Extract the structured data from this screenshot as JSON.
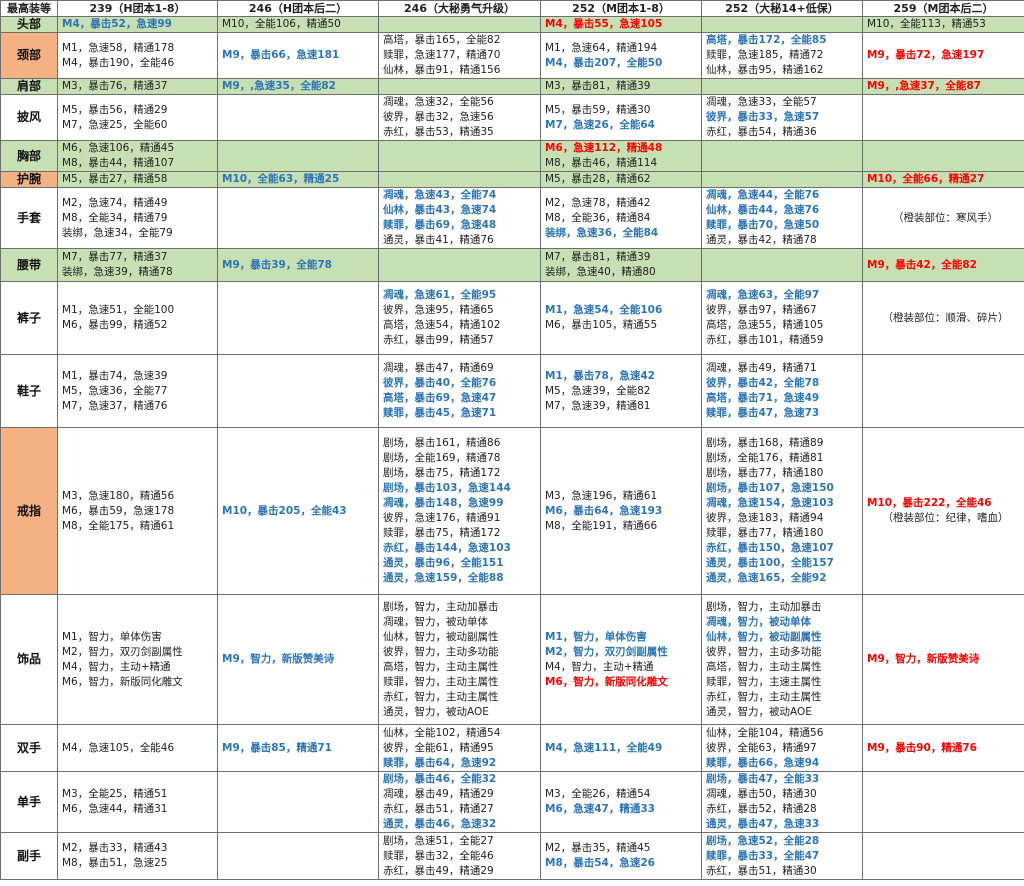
{
  "header": [
    "最高装等",
    "239（H团本1-8）",
    "246（H团本后二）",
    "246（大秘勇气升级）",
    "252（M团本1-8）",
    "252（大秘14+低保）",
    "259（M团本后二）"
  ],
  "rows": [
    {
      "slot": "头部",
      "green": true,
      "orange": false,
      "h": 15,
      "cells": [
        [
          {
            "t": "M4，暴击52，急速99",
            "c": "blue"
          }
        ],
        [
          {
            "t": "M10，全能106，精通50",
            "c": ""
          }
        ],
        [],
        [
          {
            "t": "M4，暴击55，急速105",
            "c": "red"
          }
        ],
        [],
        [
          {
            "t": "M10，全能113，精通53",
            "c": ""
          }
        ]
      ]
    },
    {
      "slot": "颈部",
      "green": false,
      "orange": true,
      "h": 46,
      "cells": [
        [
          {
            "t": "M1，急速58，精通178",
            "c": ""
          },
          {
            "t": "M4，暴击190，全能46",
            "c": ""
          }
        ],
        [
          {
            "t": "M9，暴击66，急速181",
            "c": "blue"
          }
        ],
        [
          {
            "t": "高塔，暴击165，全能82",
            "c": ""
          },
          {
            "t": "赎罪，急速177，精通70",
            "c": ""
          },
          {
            "t": "仙林，暴击91，精通156",
            "c": ""
          }
        ],
        [
          {
            "t": "M1，急速64，精通194",
            "c": ""
          },
          {
            "t": "M4，暴击207，全能50",
            "c": "blue"
          }
        ],
        [
          {
            "t": "高塔，暴击172，全能85",
            "c": "blue"
          },
          {
            "t": "赎罪，急速185，精通72",
            "c": ""
          },
          {
            "t": "仙林，暴击95，精通162",
            "c": ""
          }
        ],
        [
          {
            "t": "M9，暴击72，急速197",
            "c": "red"
          }
        ]
      ]
    },
    {
      "slot": "肩部",
      "green": true,
      "orange": false,
      "h": 15,
      "cells": [
        [
          {
            "t": "M3，暴击76，精通37",
            "c": ""
          }
        ],
        [
          {
            "t": "M9，,急速35，全能82",
            "c": "blue"
          }
        ],
        [],
        [
          {
            "t": "M3，暴击81，精通39",
            "c": ""
          }
        ],
        [],
        [
          {
            "t": "M9，,急速37，全能87",
            "c": "red"
          }
        ]
      ]
    },
    {
      "slot": "披风",
      "green": false,
      "orange": false,
      "h": 46,
      "cells": [
        [
          {
            "t": "M5，暴击56，精通29",
            "c": ""
          },
          {
            "t": "M7，急速25，全能60",
            "c": ""
          }
        ],
        [],
        [
          {
            "t": "凋魂，急速32，全能56",
            "c": ""
          },
          {
            "t": "彼界，暴击32，急速56",
            "c": ""
          },
          {
            "t": "赤红，暴击53，精通35",
            "c": ""
          }
        ],
        [
          {
            "t": "M5，暴击59，精通30",
            "c": ""
          },
          {
            "t": "M7，急速26，全能64",
            "c": "blue"
          }
        ],
        [
          {
            "t": "凋魂，急速33，全能57",
            "c": ""
          },
          {
            "t": "彼界，暴击33，急速57",
            "c": "blue"
          },
          {
            "t": "赤红，暴击54，精通36",
            "c": ""
          }
        ],
        []
      ]
    },
    {
      "slot": "胸部",
      "green": true,
      "orange": false,
      "h": 31,
      "cells": [
        [
          {
            "t": "M6，急速106，精通45",
            "c": ""
          },
          {
            "t": "M8，暴击44，精通107",
            "c": ""
          }
        ],
        [],
        [],
        [
          {
            "t": "M6，急速112，精通48",
            "c": "red"
          },
          {
            "t": "M8，暴击46，精通114",
            "c": ""
          }
        ],
        [],
        []
      ]
    },
    {
      "slot": "护腕",
      "green": true,
      "orange": true,
      "h": 15,
      "cells": [
        [
          {
            "t": "M5，暴击27，精通58",
            "c": ""
          }
        ],
        [
          {
            "t": "M10，全能63，精通25",
            "c": "blue"
          }
        ],
        [],
        [
          {
            "t": "M5，暴击28，精通62",
            "c": ""
          }
        ],
        [],
        [
          {
            "t": "M10，全能66，精通27",
            "c": "red"
          }
        ]
      ]
    },
    {
      "slot": "手套",
      "green": false,
      "orange": false,
      "h": 61,
      "cells": [
        [
          {
            "t": "M2，急速74，精通49",
            "c": ""
          },
          {
            "t": "M8，全能34，精通79",
            "c": ""
          },
          {
            "t": "装绑，急速34，全能79",
            "c": ""
          }
        ],
        [],
        [
          {
            "t": "凋魂，急速43，全能74",
            "c": "blue"
          },
          {
            "t": "仙林，暴击43，急速74",
            "c": "blue"
          },
          {
            "t": "赎罪，暴击69，急速48",
            "c": "blue"
          },
          {
            "t": "通灵，暴击41，精通76",
            "c": ""
          }
        ],
        [
          {
            "t": "M2，急速78，精通42",
            "c": ""
          },
          {
            "t": "M8，全能36，精通84",
            "c": ""
          },
          {
            "t": "装绑，急速36，全能84",
            "c": "blue"
          }
        ],
        [
          {
            "t": "凋魂，急速44，全能76",
            "c": "blue"
          },
          {
            "t": "仙林，暴击44，急速76",
            "c": "blue"
          },
          {
            "t": "赎罪，暴击70，急速50",
            "c": "blue"
          },
          {
            "t": "通灵，暴击42，精通78",
            "c": ""
          }
        ],
        [
          {
            "t": "（橙装部位：寒风手）",
            "c": "note"
          }
        ]
      ]
    },
    {
      "slot": "腰带",
      "green": true,
      "orange": false,
      "h": 33,
      "cells": [
        [
          {
            "t": "M7，暴击77，精通37",
            "c": ""
          },
          {
            "t": "装绑，急速39，精通78",
            "c": ""
          }
        ],
        [
          {
            "t": "M9，暴击39，全能78",
            "c": "blue"
          }
        ],
        [],
        [
          {
            "t": "M7，暴击81，精通39",
            "c": ""
          },
          {
            "t": "装绑，急速40，精通80",
            "c": ""
          }
        ],
        [],
        [
          {
            "t": "M9，暴击42，全能82",
            "c": "red"
          }
        ]
      ]
    },
    {
      "slot": "裤子",
      "green": false,
      "orange": false,
      "h": 73,
      "cells": [
        [
          {
            "t": "M1，急速51，全能100",
            "c": ""
          },
          {
            "t": "M6，暴击99，精通52",
            "c": ""
          }
        ],
        [],
        [
          {
            "t": "凋魂，急速61，全能95",
            "c": "blue"
          },
          {
            "t": "彼界，急速95，精通65",
            "c": ""
          },
          {
            "t": "高塔，急速54，精通102",
            "c": ""
          },
          {
            "t": "赤红，暴击99，精通57",
            "c": ""
          }
        ],
        [
          {
            "t": "M1，急速54，全能106",
            "c": "blue"
          },
          {
            "t": "M6，暴击105，精通55",
            "c": ""
          }
        ],
        [
          {
            "t": "凋魂，急速63，全能97",
            "c": "blue"
          },
          {
            "t": "彼界，暴击97，精通67",
            "c": ""
          },
          {
            "t": "高塔，急速55，精通105",
            "c": ""
          },
          {
            "t": "赤红，暴击101，精通59",
            "c": ""
          }
        ],
        [
          {
            "t": "（橙装部位：顺滑、碎片）",
            "c": "note"
          }
        ]
      ]
    },
    {
      "slot": "鞋子",
      "green": false,
      "orange": false,
      "h": 73,
      "cells": [
        [
          {
            "t": "M1，暴击74，急速39",
            "c": ""
          },
          {
            "t": "M5，急速36，全能77",
            "c": ""
          },
          {
            "t": "M7，急速37，精通76",
            "c": ""
          }
        ],
        [],
        [
          {
            "t": "凋魂，暴击47，精通69",
            "c": ""
          },
          {
            "t": "彼界，暴击40，全能76",
            "c": "blue"
          },
          {
            "t": "高塔，暴击69，急速47",
            "c": "blue"
          },
          {
            "t": "赎罪，暴击45，急速71",
            "c": "blue"
          }
        ],
        [
          {
            "t": "M1，暴击78，急速42",
            "c": "blue"
          },
          {
            "t": "M5，急速39，全能82",
            "c": ""
          },
          {
            "t": "M7，急速39，精通81",
            "c": ""
          }
        ],
        [
          {
            "t": "凋魂，暴击49，精通71",
            "c": ""
          },
          {
            "t": "彼界，暴击42，全能78",
            "c": "blue"
          },
          {
            "t": "高塔，暴击71，急速49",
            "c": "blue"
          },
          {
            "t": "赎罪，暴击47，急速73",
            "c": "blue"
          }
        ],
        []
      ]
    },
    {
      "slot": "戒指",
      "green": false,
      "orange": true,
      "h": 167,
      "cells": [
        [
          {
            "t": "M3，急速180，精通56",
            "c": ""
          },
          {
            "t": "M6，暴击59，急速178",
            "c": ""
          },
          {
            "t": "M8，全能175，精通61",
            "c": ""
          }
        ],
        [
          {
            "t": "M10，暴击205，全能43",
            "c": "blue"
          }
        ],
        [
          {
            "t": "剧场，暴击161，精通86",
            "c": ""
          },
          {
            "t": "剧场，全能169，精通78",
            "c": ""
          },
          {
            "t": "剧场，暴击75，精通172",
            "c": ""
          },
          {
            "t": "剧场，暴击103，急速144",
            "c": "blue"
          },
          {
            "t": "凋魂，暴击148，急速99",
            "c": "blue"
          },
          {
            "t": "彼界，急速176，精通91",
            "c": ""
          },
          {
            "t": "赎罪，暴击75，精通172",
            "c": ""
          },
          {
            "t": "赤红，暴击144，急速103",
            "c": "blue"
          },
          {
            "t": "通灵，暴击96，全能151",
            "c": "blue"
          },
          {
            "t": "通灵，急速159，全能88",
            "c": "blue"
          }
        ],
        [
          {
            "t": "M3，急速196，精通61",
            "c": ""
          },
          {
            "t": "M6，暴击64，急速193",
            "c": "blue"
          },
          {
            "t": "M8，全能191，精通66",
            "c": ""
          }
        ],
        [
          {
            "t": "剧场，暴击168，精通89",
            "c": ""
          },
          {
            "t": "剧场，全能176，精通81",
            "c": ""
          },
          {
            "t": "剧场，暴击77，精通180",
            "c": ""
          },
          {
            "t": "剧场，暴击107，急速150",
            "c": "blue"
          },
          {
            "t": "凋魂，急速154，急速103",
            "c": "blue"
          },
          {
            "t": "彼界，急速183，精通94",
            "c": ""
          },
          {
            "t": "赎罪，暴击77，精通180",
            "c": ""
          },
          {
            "t": "赤红，暴击150，急速107",
            "c": "blue"
          },
          {
            "t": "通灵，暴击100，全能157",
            "c": "blue"
          },
          {
            "t": "通灵，急速165，全能92",
            "c": "blue"
          }
        ],
        [
          {
            "t": "M10，暴击222，全能46",
            "c": "red"
          },
          {
            "t": "（橙装部位：纪律，嗜血）",
            "c": "note"
          }
        ]
      ]
    },
    {
      "slot": "饰品",
      "green": false,
      "orange": false,
      "h": 130,
      "cells": [
        [
          {
            "t": "M1，智力，单体伤害",
            "c": ""
          },
          {
            "t": "M2，智力，双刃剑副属性",
            "c": ""
          },
          {
            "t": "M4，智力，主动+精通",
            "c": ""
          },
          {
            "t": "M6，智力，新版同化雕文",
            "c": ""
          }
        ],
        [
          {
            "t": "M9，智力，新版赞美诗",
            "c": "blue"
          }
        ],
        [
          {
            "t": "剧场，智力，主动加暴击",
            "c": ""
          },
          {
            "t": "凋魂，智力，被动单体",
            "c": ""
          },
          {
            "t": "仙林，智力，被动副属性",
            "c": ""
          },
          {
            "t": "彼界，智力，主动多功能",
            "c": ""
          },
          {
            "t": "高塔，智力，主动主属性",
            "c": ""
          },
          {
            "t": "赎罪，智力，主动主属性",
            "c": ""
          },
          {
            "t": "赤红，智力，主动主属性",
            "c": ""
          },
          {
            "t": "通灵，智力，被动AOE",
            "c": ""
          }
        ],
        [
          {
            "t": "M1，智力，单体伤害",
            "c": "blue"
          },
          {
            "t": "M2，智力，双刃剑副属性",
            "c": "blue"
          },
          {
            "t": "M4，智力，主动+精通",
            "c": ""
          },
          {
            "t": "M6，智力，新版同化雕文",
            "c": "red"
          }
        ],
        [
          {
            "t": "剧场，智力，主动加暴击",
            "c": ""
          },
          {
            "t": "凋魂，智力，被动单体",
            "c": "blue"
          },
          {
            "t": "仙林，智力，被动副属性",
            "c": "blue"
          },
          {
            "t": "彼界，智力，主动多功能",
            "c": ""
          },
          {
            "t": "高塔，智力，主动主属性",
            "c": ""
          },
          {
            "t": "赎罪，智力，主速主属性",
            "c": ""
          },
          {
            "t": "赤红，智力，主动主属性",
            "c": ""
          },
          {
            "t": "通灵，智力，被动AOE",
            "c": ""
          }
        ],
        [
          {
            "t": "M9，智力，新版赞美诗",
            "c": "red"
          }
        ]
      ]
    },
    {
      "slot": "双手",
      "green": false,
      "orange": false,
      "h": 47,
      "cells": [
        [
          {
            "t": "M4，急速105，全能46",
            "c": ""
          }
        ],
        [
          {
            "t": "M9，暴击85，精通71",
            "c": "blue"
          }
        ],
        [
          {
            "t": "仙林，全能102，精通54",
            "c": ""
          },
          {
            "t": "彼界，全能61，精通95",
            "c": ""
          },
          {
            "t": "赎罪，暴击64，急速92",
            "c": "blue"
          }
        ],
        [
          {
            "t": "M4，急速111，全能49",
            "c": "blue"
          }
        ],
        [
          {
            "t": "仙林，全能104，精通56",
            "c": ""
          },
          {
            "t": "彼界，全能63，精通97",
            "c": ""
          },
          {
            "t": "赎罪，暴击66，急速94",
            "c": "blue"
          }
        ],
        [
          {
            "t": "M9，暴击90，精通76",
            "c": "red"
          }
        ]
      ]
    },
    {
      "slot": "单手",
      "green": false,
      "orange": false,
      "h": 61,
      "cells": [
        [
          {
            "t": "M3，全能25，精通51",
            "c": ""
          },
          {
            "t": "M6，急速44，精通31",
            "c": ""
          }
        ],
        [],
        [
          {
            "t": "剧场，暴击46，全能32",
            "c": "blue"
          },
          {
            "t": "凋魂，暴击49，精通29",
            "c": ""
          },
          {
            "t": "赤红，暴击51，精通27",
            "c": ""
          },
          {
            "t": "通灵，暴击46，急速32",
            "c": "blue"
          }
        ],
        [
          {
            "t": "M3，全能26，精通54",
            "c": ""
          },
          {
            "t": "M6，急速47，精通33",
            "c": "blue"
          }
        ],
        [
          {
            "t": "剧场，暴击47，全能33",
            "c": "blue"
          },
          {
            "t": "凋魂，暴击50，精通30",
            "c": ""
          },
          {
            "t": "赤红，暴击52，精通28",
            "c": ""
          },
          {
            "t": "通灵，暴击47，急速33",
            "c": "blue"
          }
        ],
        []
      ]
    },
    {
      "slot": "副手",
      "green": false,
      "orange": false,
      "h": 47,
      "cells": [
        [
          {
            "t": "M2，暴击33，精通43",
            "c": ""
          },
          {
            "t": "M8，暴击51，急速25",
            "c": ""
          }
        ],
        [],
        [
          {
            "t": "剧场，急速51，全能27",
            "c": ""
          },
          {
            "t": "赎罪，暴击32，全能46",
            "c": ""
          },
          {
            "t": "赤红，暴击49，精通29",
            "c": ""
          }
        ],
        [
          {
            "t": "M2，暴击35，精通45",
            "c": ""
          },
          {
            "t": "M8，暴击54，急速26",
            "c": "blue"
          }
        ],
        [
          {
            "t": "剧场，急速52，全能28",
            "c": "blue"
          },
          {
            "t": "赎罪，暴击33，全能47",
            "c": "blue"
          },
          {
            "t": "赤红，暴击51，精通30",
            "c": ""
          }
        ],
        []
      ]
    }
  ]
}
